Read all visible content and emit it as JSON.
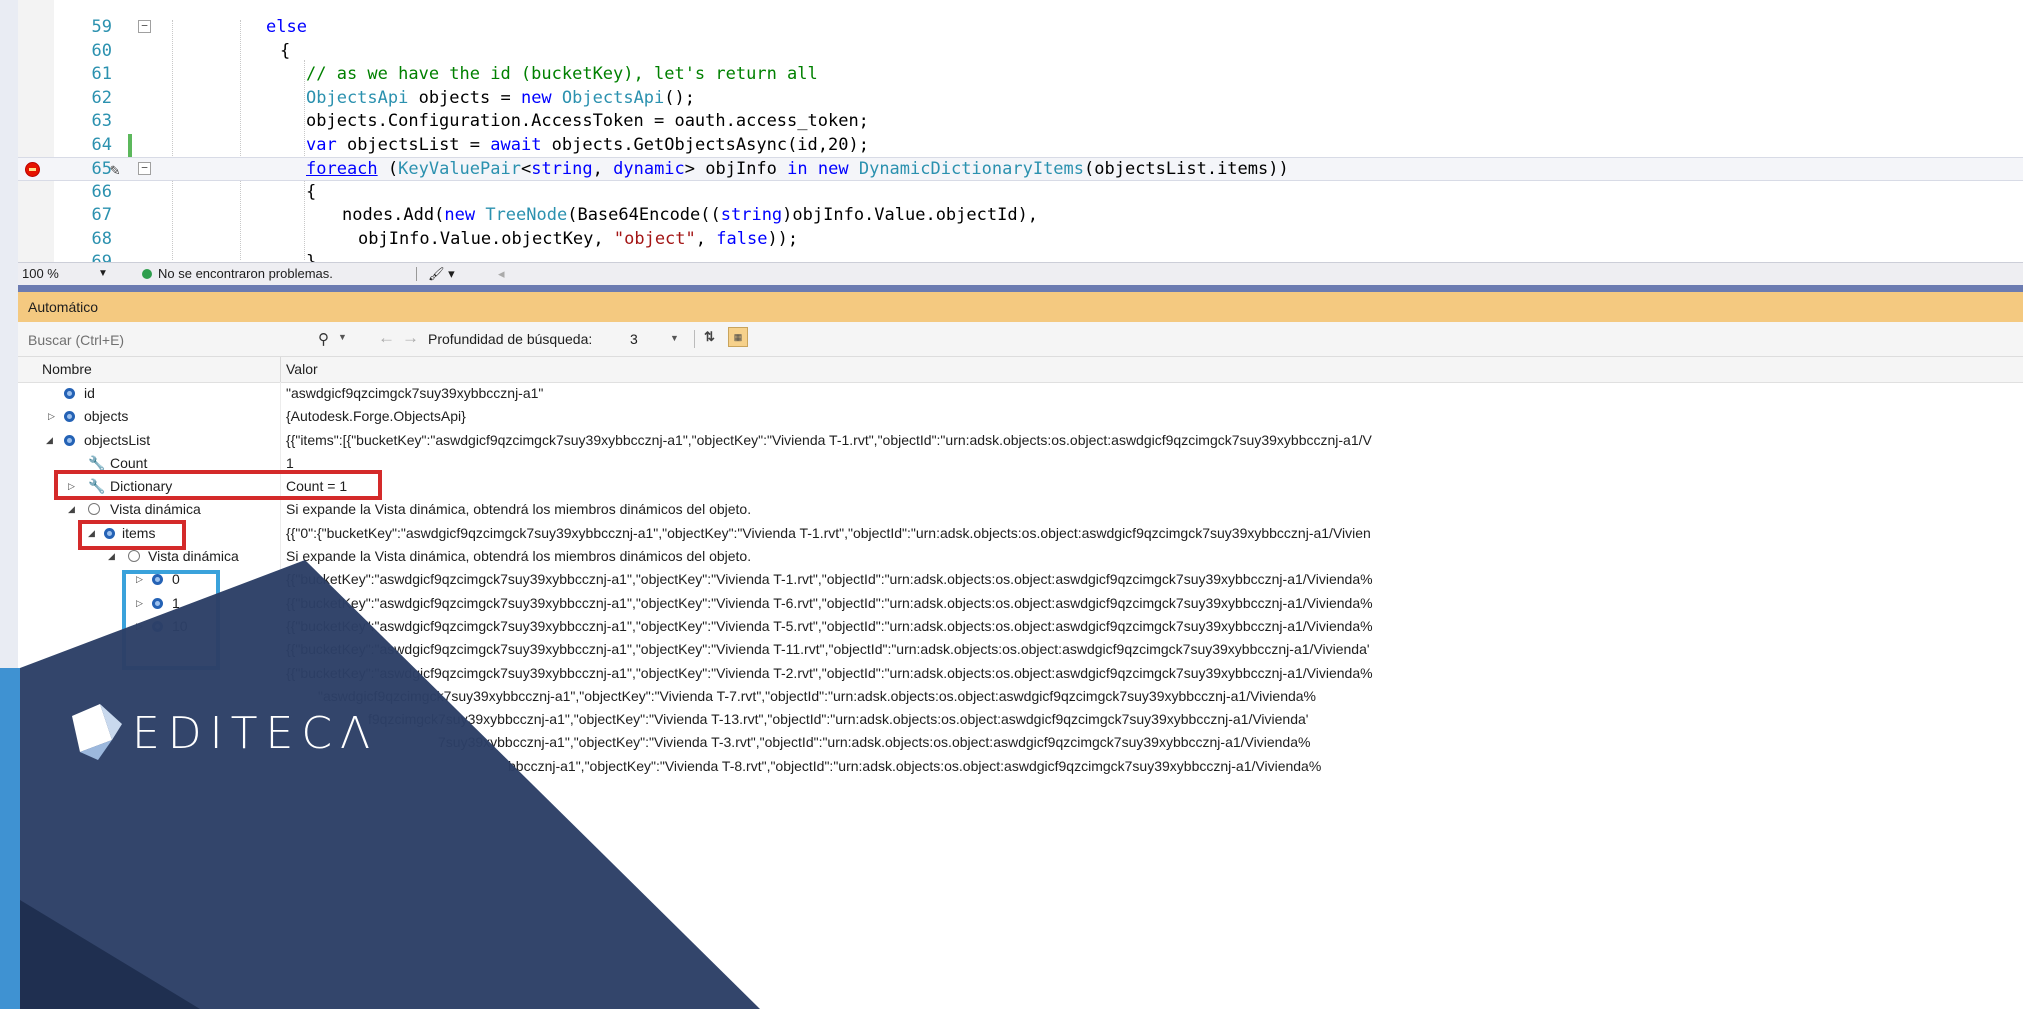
{
  "editor": {
    "lines": [
      {
        "num": "59",
        "text": "else"
      },
      {
        "num": "60",
        "text": "{"
      },
      {
        "num": "61",
        "text": "// as we have the id (bucketKey), let's return all"
      },
      {
        "num": "62",
        "text": "ObjectsApi objects = new ObjectsApi();"
      },
      {
        "num": "63",
        "text": "objects.Configuration.AccessToken = oauth.access_token;"
      },
      {
        "num": "64",
        "text": "var objectsList = await objects.GetObjectsAsync(id,20);"
      },
      {
        "num": "65",
        "text": "foreach (KeyValuePair<string, dynamic> objInfo in new DynamicDictionaryItems(objectsList.items))"
      },
      {
        "num": "66",
        "text": "{"
      },
      {
        "num": "67",
        "text": "nodes.Add(new TreeNode(Base64Encode((string)objInfo.Value.objectId),"
      },
      {
        "num": "68",
        "text": "objInfo.Value.objectKey, \"object\", false));"
      },
      {
        "num": "69",
        "text": "}"
      }
    ]
  },
  "status": {
    "zoom": "100 %",
    "message": "No se encontraron problemas."
  },
  "autos": {
    "title": "Automático",
    "search_placeholder": "Buscar (Ctrl+E)",
    "depth_label": "Profundidad de búsqueda:",
    "depth_value": "3",
    "col_name": "Nombre",
    "col_value": "Valor",
    "rows": [
      {
        "name": "id",
        "value": "\"aswdgicf9qzcimgck7suy39xybbccznj-a1\""
      },
      {
        "name": "objects",
        "value": "{Autodesk.Forge.ObjectsApi}"
      },
      {
        "name": "objectsList",
        "value": "{{\"items\":[{\"bucketKey\":\"aswdgicf9qzcimgck7suy39xybbccznj-a1\",\"objectKey\":\"Vivienda T-1.rvt\",\"objectId\":\"urn:adsk.objects:os.object:aswdgicf9qzcimgck7suy39xybbccznj-a1/V"
      },
      {
        "name": "Count",
        "value": "1"
      },
      {
        "name": "Dictionary",
        "value": "Count = 1"
      },
      {
        "name": "Vista dinámica",
        "value": "Si expande la Vista dinámica, obtendrá los miembros dinámicos del objeto."
      },
      {
        "name": "items",
        "value": "{{\"0\":{\"bucketKey\":\"aswdgicf9qzcimgck7suy39xybbccznj-a1\",\"objectKey\":\"Vivienda T-1.rvt\",\"objectId\":\"urn:adsk.objects:os.object:aswdgicf9qzcimgck7suy39xybbccznj-a1/Vivien"
      },
      {
        "name": "Vista dinámica",
        "value": "Si expande la Vista dinámica, obtendrá los miembros dinámicos del objeto."
      },
      {
        "name": "0",
        "value": "{{\"bucketKey\":\"aswdgicf9qzcimgck7suy39xybbccznj-a1\",\"objectKey\":\"Vivienda T-1.rvt\",\"objectId\":\"urn:adsk.objects:os.object:aswdgicf9qzcimgck7suy39xybbccznj-a1/Vivienda%"
      },
      {
        "name": "1",
        "value": "{{\"bucketKey\":\"aswdgicf9qzcimgck7suy39xybbccznj-a1\",\"objectKey\":\"Vivienda T-6.rvt\",\"objectId\":\"urn:adsk.objects:os.object:aswdgicf9qzcimgck7suy39xybbccznj-a1/Vivienda%"
      },
      {
        "name": "10",
        "value": "{{\"bucketKey\":\"aswdgicf9qzcimgck7suy39xybbccznj-a1\",\"objectKey\":\"Vivienda T-5.rvt\",\"objectId\":\"urn:adsk.objects:os.object:aswdgicf9qzcimgck7suy39xybbccznj-a1/Vivienda%"
      },
      {
        "name": "",
        "value": "{{\"bucketKey\":\"aswdgicf9qzcimgck7suy39xybbccznj-a1\",\"objectKey\":\"Vivienda T-11.rvt\",\"objectId\":\"urn:adsk.objects:os.object:aswdgicf9qzcimgck7suy39xybbccznj-a1/Vivienda'"
      },
      {
        "name": "",
        "value": "{{\"bucketKey\":\"aswdgicf9qzcimgck7suy39xybbccznj-a1\",\"objectKey\":\"Vivienda T-2.rvt\",\"objectId\":\"urn:adsk.objects:os.object:aswdgicf9qzcimgck7suy39xybbccznj-a1/Vivienda%"
      },
      {
        "name": "",
        "value": "\"aswdgicf9qzcimgck7suy39xybbccznj-a1\",\"objectKey\":\"Vivienda T-7.rvt\",\"objectId\":\"urn:adsk.objects:os.object:aswdgicf9qzcimgck7suy39xybbccznj-a1/Vivienda%"
      },
      {
        "name": "",
        "value": "f9qzcimgck7suy39xybbccznj-a1\",\"objectKey\":\"Vivienda T-13.rvt\",\"objectId\":\"urn:adsk.objects:os.object:aswdgicf9qzcimgck7suy39xybbccznj-a1/Vivienda'"
      },
      {
        "name": "",
        "value": "7suy39xybbccznj-a1\",\"objectKey\":\"Vivienda T-3.rvt\",\"objectId\":\"urn:adsk.objects:os.object:aswdgicf9qzcimgck7suy39xybbccznj-a1/Vivienda%"
      },
      {
        "name": "",
        "value": "bbccznj-a1\",\"objectKey\":\"Vivienda T-8.rvt\",\"objectId\":\"urn:adsk.objects:os.object:aswdgicf9qzcimgck7suy39xybbccznj-a1/Vivienda%"
      }
    ]
  },
  "logo": {
    "text": "EDITECΛ"
  },
  "colors": {
    "accent_red": "#d42a2a",
    "accent_blue": "#3aa2db",
    "brand_blue": "#2f7fc4"
  }
}
